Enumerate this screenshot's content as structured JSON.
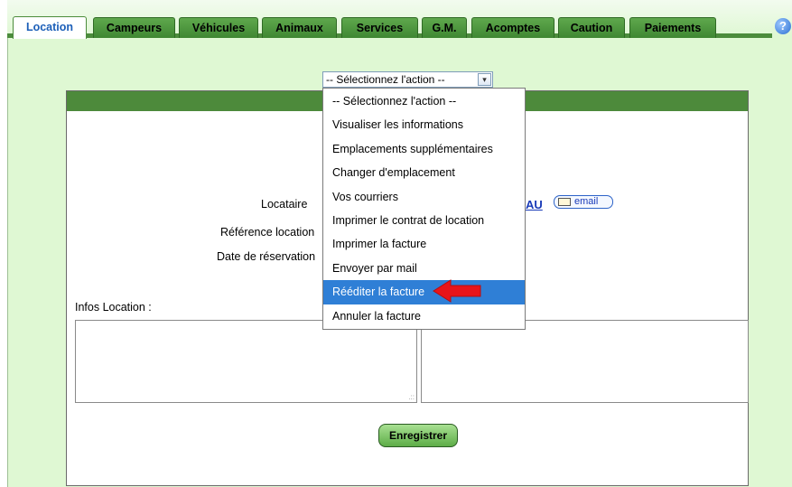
{
  "tabs": [
    "Location",
    "Campeurs",
    "Véhicules",
    "Animaux",
    "Services",
    "G.M.",
    "Acomptes",
    "Caution",
    "Paiements"
  ],
  "help_icon_glyph": "?",
  "action_select": {
    "value": "-- Sélectionnez l'action --",
    "arrow_glyph": "▾",
    "options": [
      "-- Sélectionnez l'action --",
      "Visualiser les informations",
      "Emplacements supplémentaires",
      "Changer d'emplacement",
      "Vos courriers",
      "Imprimer le contrat de location",
      "Imprimer la facture",
      "Envoyer par mail",
      "Rééditer la facture",
      "Annuler la facture"
    ],
    "highlighted_index": 8
  },
  "form": {
    "locataire_label": "Locataire",
    "reference_label": "Référence location",
    "date_label": "Date de réservation",
    "tenant_name_partial": "AU",
    "email_button": "email",
    "infos_label": "Infos Location :",
    "save_button": "Enregistrer"
  },
  "colors": {
    "accent_green": "#4d8a3b",
    "background_green": "#dff8d3",
    "highlight_blue": "#2f7fd6",
    "arrow_red": "#e8141a"
  }
}
